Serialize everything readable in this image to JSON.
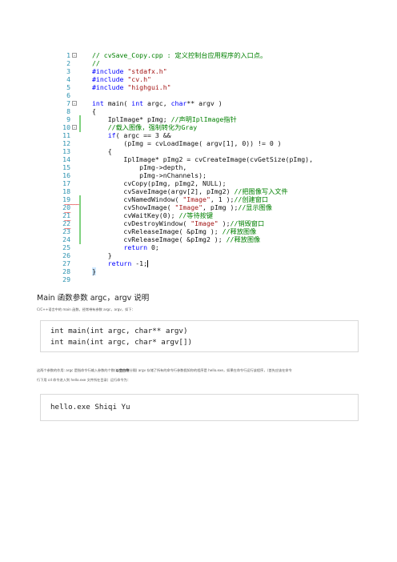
{
  "editor": {
    "lines": [
      {
        "n": "1",
        "fold": "-",
        "parts": [
          {
            "t": "// cvSave_Copy.cpp : 定义控制台应用程序的入口点。",
            "c": "cm"
          }
        ]
      },
      {
        "n": "2",
        "parts": [
          {
            "t": "//",
            "c": "cm"
          }
        ]
      },
      {
        "n": "3",
        "parts": [
          {
            "t": "#include ",
            "c": "kw"
          },
          {
            "t": "\"stdafx.h\"",
            "c": "str"
          }
        ]
      },
      {
        "n": "4",
        "parts": [
          {
            "t": "#include ",
            "c": "kw"
          },
          {
            "t": "\"cv.h\"",
            "c": "str"
          }
        ]
      },
      {
        "n": "5",
        "parts": [
          {
            "t": "#include ",
            "c": "kw"
          },
          {
            "t": "\"highgui.h\"",
            "c": "str"
          }
        ]
      },
      {
        "n": "6",
        "parts": []
      },
      {
        "n": "7",
        "fold": "-",
        "parts": [
          {
            "t": "int ",
            "c": "kw"
          },
          {
            "t": "main( ",
            "c": ""
          },
          {
            "t": "int ",
            "c": "kw"
          },
          {
            "t": "argc, ",
            "c": ""
          },
          {
            "t": "char",
            "c": "kw"
          },
          {
            "t": "** argv )",
            "c": ""
          }
        ]
      },
      {
        "n": "8",
        "parts": [
          {
            "t": "{",
            "c": ""
          }
        ]
      },
      {
        "n": "9",
        "mark": true,
        "parts": [
          {
            "t": "    IplImage* pImg; ",
            "c": ""
          },
          {
            "t": "//声明IplImage指针",
            "c": "cm"
          }
        ]
      },
      {
        "n": "10",
        "fold": "-",
        "mark": true,
        "parts": [
          {
            "t": "    //载入图像，强制转化为Gray",
            "c": "cm"
          }
        ]
      },
      {
        "n": "11",
        "parts": [
          {
            "t": "    ",
            "c": ""
          },
          {
            "t": "if",
            "c": "kw"
          },
          {
            "t": "( argc == 3 &&",
            "c": ""
          }
        ]
      },
      {
        "n": "12",
        "parts": [
          {
            "t": "        (pImg = cvLoadImage( argv[1], 0)) != 0 )",
            "c": ""
          }
        ]
      },
      {
        "n": "13",
        "parts": [
          {
            "t": "    {",
            "c": ""
          }
        ]
      },
      {
        "n": "14",
        "parts": [
          {
            "t": "        IplImage* pImg2 = cvCreateImage(cvGetSize(pImg),",
            "c": ""
          }
        ]
      },
      {
        "n": "15",
        "parts": [
          {
            "t": "            pImg->depth,",
            "c": ""
          }
        ]
      },
      {
        "n": "16",
        "parts": [
          {
            "t": "            pImg->nChannels);",
            "c": ""
          }
        ]
      },
      {
        "n": "17",
        "parts": [
          {
            "t": "        cvCopy(pImg, pImg2, NULL);",
            "c": ""
          }
        ]
      },
      {
        "n": "18",
        "parts": [
          {
            "t": "        cvSaveImage(argv[2], pImg2) ",
            "c": ""
          },
          {
            "t": "//把图像写入文件",
            "c": "cm"
          }
        ]
      },
      {
        "n": "19",
        "squiggle": "~~~~~",
        "mark": true,
        "parts": [
          {
            "t": "        cvNamedWindow( ",
            "c": ""
          },
          {
            "t": "\"Image\"",
            "c": "str"
          },
          {
            "t": ", 1 );",
            "c": ""
          },
          {
            "t": "//创建窗口",
            "c": "cm"
          }
        ]
      },
      {
        "n": "20",
        "squiggle": "~~",
        "mark": true,
        "parts": [
          {
            "t": "        cvShowImage( ",
            "c": ""
          },
          {
            "t": "\"Image\"",
            "c": "str"
          },
          {
            "t": ", pImg );",
            "c": ""
          },
          {
            "t": "//显示图像",
            "c": "cm"
          }
        ]
      },
      {
        "n": "21",
        "squiggle": "~~",
        "mark": true,
        "parts": [
          {
            "t": "        cvWaitKey(0); ",
            "c": ""
          },
          {
            "t": "//等待按键",
            "c": "cm"
          }
        ]
      },
      {
        "n": "22",
        "squiggle": "~~",
        "mark": true,
        "parts": [
          {
            "t": "        cvDestroyWindow( ",
            "c": ""
          },
          {
            "t": "\"Image\"",
            "c": "str"
          },
          {
            "t": " );",
            "c": ""
          },
          {
            "t": "//销毁窗口",
            "c": "cm"
          }
        ]
      },
      {
        "n": "23",
        "mark": true,
        "parts": [
          {
            "t": "        cvReleaseImage( &pImg ); ",
            "c": ""
          },
          {
            "t": "//释放图像",
            "c": "cm"
          }
        ]
      },
      {
        "n": "24",
        "mark": true,
        "parts": [
          {
            "t": "        cvReleaseImage( &pImg2 ); ",
            "c": ""
          },
          {
            "t": "//释放图像",
            "c": "cm"
          }
        ]
      },
      {
        "n": "25",
        "parts": [
          {
            "t": "        ",
            "c": ""
          },
          {
            "t": "return",
            "c": "kw"
          },
          {
            "t": " 0;",
            "c": ""
          }
        ]
      },
      {
        "n": "26",
        "parts": [
          {
            "t": "    }",
            "c": ""
          }
        ]
      },
      {
        "n": "27",
        "cursor": true,
        "parts": [
          {
            "t": "    ",
            "c": ""
          },
          {
            "t": "return",
            "c": "kw"
          },
          {
            "t": " -1;",
            "c": ""
          }
        ]
      },
      {
        "n": "28",
        "parts": [
          {
            "t": "}",
            "c": "hl"
          }
        ]
      },
      {
        "n": "29",
        "parts": []
      }
    ]
  },
  "article": {
    "heading": "Main 函数参数 argc，argv 说明",
    "intro": "C/C++语言中的 main 函数，经常带有参数 argc，argv，如下：",
    "signature_lines": [
      "int main(int argc, char** argv)",
      "int main(int argc, char* argv[])"
    ],
    "para1_a": "这两个参数的作用: argc 是指命令行输入参数的个数(",
    "para1_bold": "以空白符",
    "para1_b": "分隔) argv 存储了所有的命令行参数假如你的程序是 hello.exe，如果在命令行运行该程序，（首先应该在命令",
    "para2": "行下用 cd 命令进入到 hello.exe 文件所在目录）运行命令为：",
    "command": "hello.exe Shiqi Yu"
  }
}
